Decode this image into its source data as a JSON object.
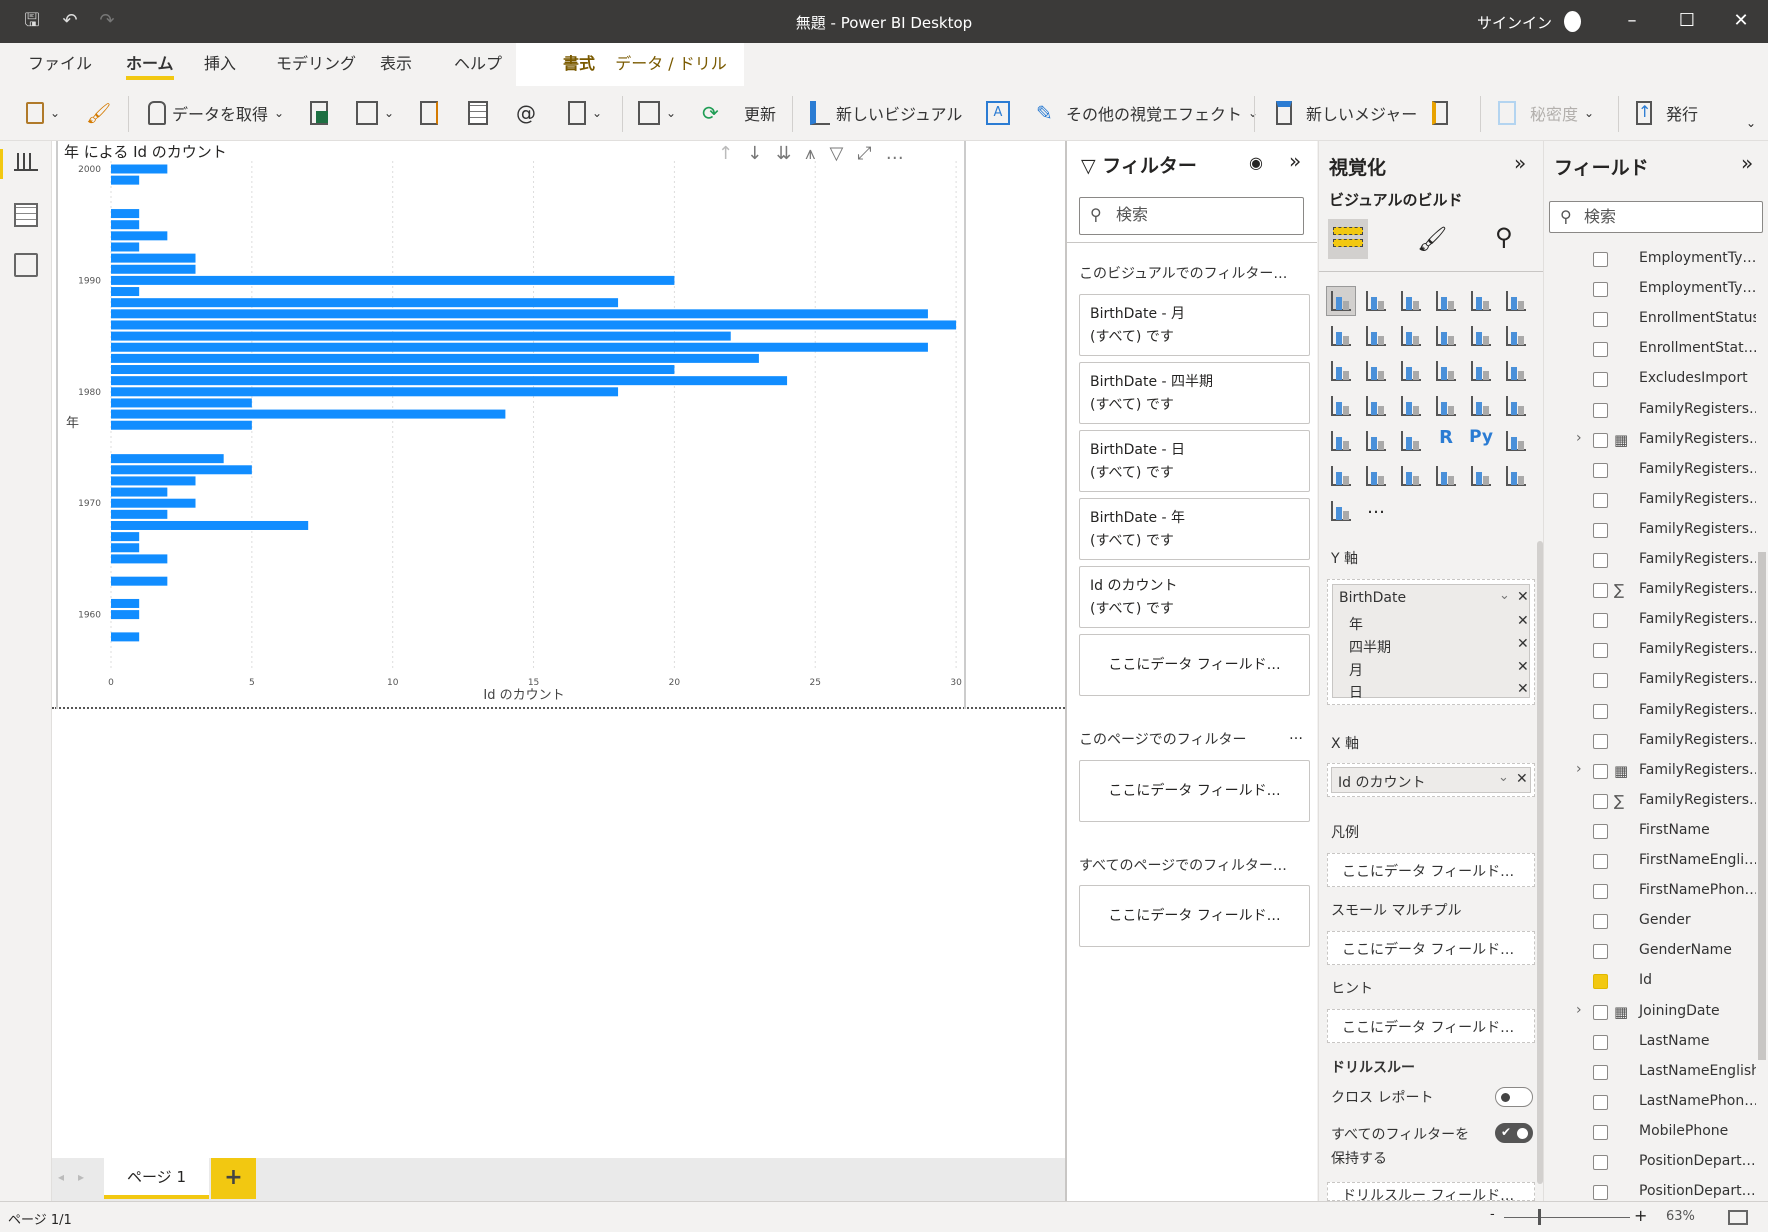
{
  "titlebar": {
    "title": "無題 - Power BI Desktop",
    "signin": "サインイン"
  },
  "tabs": [
    "ファイル",
    "ホーム",
    "挿入",
    "モデリング",
    "表示",
    "ヘルプ",
    "書式",
    "データ / ドリル"
  ],
  "ribbon": {
    "get_data": "データを取得",
    "refresh": "更新",
    "new_visual": "新しいビジュアル",
    "more_visuals": "その他の視覚エフェクト",
    "new_measure": "新しいメジャー",
    "sensitivity": "秘密度",
    "publish": "発行"
  },
  "visual": {
    "toolbar_more": "…"
  },
  "chart_data": {
    "type": "bar",
    "orientation": "horizontal",
    "title": "年 による Id のカウント",
    "xlabel": "Id のカウント",
    "ylabel": "年",
    "xlim": [
      0,
      30
    ],
    "xticks": [
      0,
      5,
      10,
      15,
      20,
      25,
      30
    ],
    "ytick_labels": [
      "2000",
      "1990",
      "1980",
      "1970",
      "1960"
    ],
    "color": "#118dff",
    "categories": [
      2000,
      1999,
      1998,
      1997,
      1996,
      1995,
      1994,
      1993,
      1992,
      1991,
      1990,
      1989,
      1988,
      1987,
      1986,
      1985,
      1984,
      1983,
      1982,
      1981,
      1980,
      1979,
      1978,
      1977,
      1976,
      1975,
      1974,
      1973,
      1972,
      1971,
      1970,
      1969,
      1968,
      1967,
      1966,
      1965,
      1964,
      1963,
      1962,
      1961,
      1960,
      1959,
      1958
    ],
    "values": [
      2,
      1,
      0,
      0,
      1,
      1,
      2,
      1,
      3,
      3,
      20,
      1,
      18,
      29,
      30,
      22,
      29,
      23,
      20,
      24,
      18,
      5,
      14,
      5,
      0,
      0,
      4,
      5,
      3,
      2,
      3,
      2,
      7,
      1,
      1,
      2,
      0,
      2,
      0,
      1,
      1,
      0,
      1
    ]
  },
  "filters": {
    "title": "フィルター",
    "search_placeholder": "検索",
    "visual_section": "このビジュアルでのフィルター…",
    "cards": [
      {
        "name": "BirthDate - 月",
        "state": "(すべて) です"
      },
      {
        "name": "BirthDate - 四半期",
        "state": "(すべて) です"
      },
      {
        "name": "BirthDate - 日",
        "state": "(すべて) です"
      },
      {
        "name": "BirthDate - 年",
        "state": "(すべて) です"
      },
      {
        "name": "Id のカウント",
        "state": "(すべて) です"
      }
    ],
    "drop_here": "ここにデータ フィールド…",
    "page_section": "このページでのフィルター",
    "page_more": "…",
    "all_pages_section": "すべてのページでのフィルター…"
  },
  "viz": {
    "title": "視覚化",
    "subtitle": "ビジュアルのビルド",
    "more_label": "…",
    "y_axis": "Y 軸",
    "y_field": "BirthDate",
    "y_sub": [
      "年",
      "四半期",
      "月",
      "日"
    ],
    "x_axis": "X 軸",
    "x_field": "Id のカウント",
    "legend": "凡例",
    "small_multiples": "スモール マルチプル",
    "tooltips": "ヒント",
    "drop_here": "ここにデータ フィールド…",
    "drillthrough": "ドリルスルー",
    "cross_report": "クロス レポート",
    "cross_report_on": false,
    "keep_filters": "すべてのフィルターを保持する",
    "keep_filters_on": true,
    "drill_fields": "ドリルスルー フィールド…"
  },
  "fields": {
    "title": "フィールド",
    "search_placeholder": "検索",
    "items": [
      {
        "name": "EmploymentTy…",
        "type": "",
        "checked": false
      },
      {
        "name": "EmploymentTy…",
        "type": "",
        "checked": false
      },
      {
        "name": "EnrollmentStatus",
        "type": "",
        "checked": false
      },
      {
        "name": "EnrollmentStat…",
        "type": "",
        "checked": false
      },
      {
        "name": "ExcludesImport",
        "type": "",
        "checked": false
      },
      {
        "name": "FamilyRegisters…",
        "type": "",
        "checked": false
      },
      {
        "name": "FamilyRegisters…",
        "type": "date",
        "checked": false
      },
      {
        "name": "FamilyRegisters…",
        "type": "",
        "checked": false
      },
      {
        "name": "FamilyRegisters…",
        "type": "",
        "checked": false
      },
      {
        "name": "FamilyRegisters…",
        "type": "",
        "checked": false
      },
      {
        "name": "FamilyRegisters…",
        "type": "",
        "checked": false
      },
      {
        "name": "FamilyRegisters…",
        "type": "sum",
        "checked": false
      },
      {
        "name": "FamilyRegisters…",
        "type": "",
        "checked": false
      },
      {
        "name": "FamilyRegisters…",
        "type": "",
        "checked": false
      },
      {
        "name": "FamilyRegisters…",
        "type": "",
        "checked": false
      },
      {
        "name": "FamilyRegisters…",
        "type": "",
        "checked": false
      },
      {
        "name": "FamilyRegisters…",
        "type": "",
        "checked": false
      },
      {
        "name": "FamilyRegisters…",
        "type": "date",
        "checked": false
      },
      {
        "name": "FamilyRegisters…",
        "type": "sum",
        "checked": false
      },
      {
        "name": "FirstName",
        "type": "",
        "checked": false
      },
      {
        "name": "FirstNameEngli…",
        "type": "",
        "checked": false
      },
      {
        "name": "FirstNamePhon…",
        "type": "",
        "checked": false
      },
      {
        "name": "Gender",
        "type": "",
        "checked": false
      },
      {
        "name": "GenderName",
        "type": "",
        "checked": false
      },
      {
        "name": "Id",
        "type": "",
        "checked": true
      },
      {
        "name": "JoiningDate",
        "type": "date",
        "checked": false
      },
      {
        "name": "LastName",
        "type": "",
        "checked": false
      },
      {
        "name": "LastNameEnglish",
        "type": "",
        "checked": false
      },
      {
        "name": "LastNamePhon…",
        "type": "",
        "checked": false
      },
      {
        "name": "MobilePhone",
        "type": "",
        "checked": false
      },
      {
        "name": "PositionDepart…",
        "type": "",
        "checked": false
      },
      {
        "name": "PositionDepart…",
        "type": "",
        "checked": false
      }
    ]
  },
  "pages": {
    "tabs": [
      "ページ 1"
    ],
    "add": "+"
  },
  "status": {
    "page": "ページ 1/1",
    "zoom": "63%",
    "zoom_minus": "-",
    "zoom_plus": "+"
  }
}
